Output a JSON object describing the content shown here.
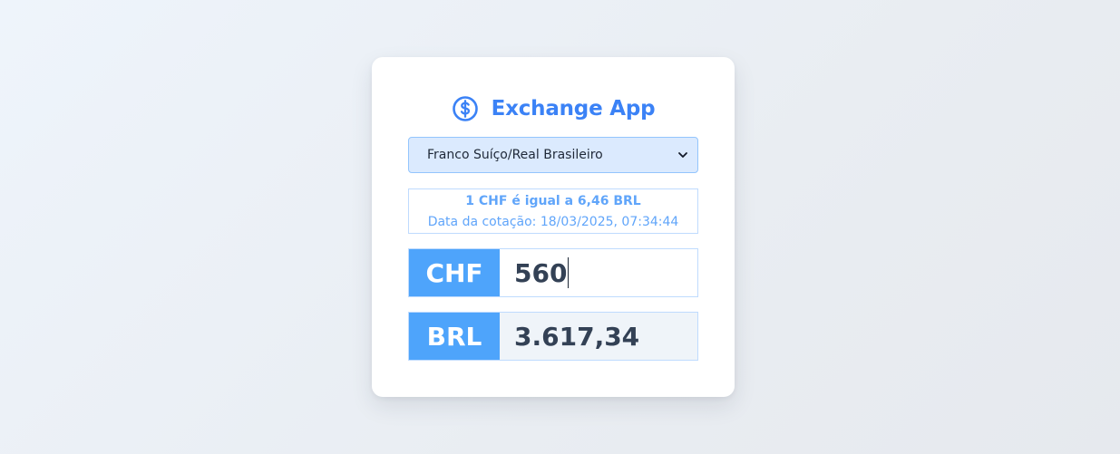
{
  "app": {
    "title": "Exchange App",
    "icon": "dollar-circle-icon",
    "accent_color": "#3b82f6"
  },
  "pair_select": {
    "selected": "Franco Suíço/Real Brasileiro"
  },
  "rate": {
    "summary": "1 CHF é igual a 6,46 BRL",
    "date": "Data da cotação: 18/03/2025, 07:34:44"
  },
  "from": {
    "code": "CHF",
    "value": "560"
  },
  "to": {
    "code": "BRL",
    "value": "3.617,34"
  }
}
